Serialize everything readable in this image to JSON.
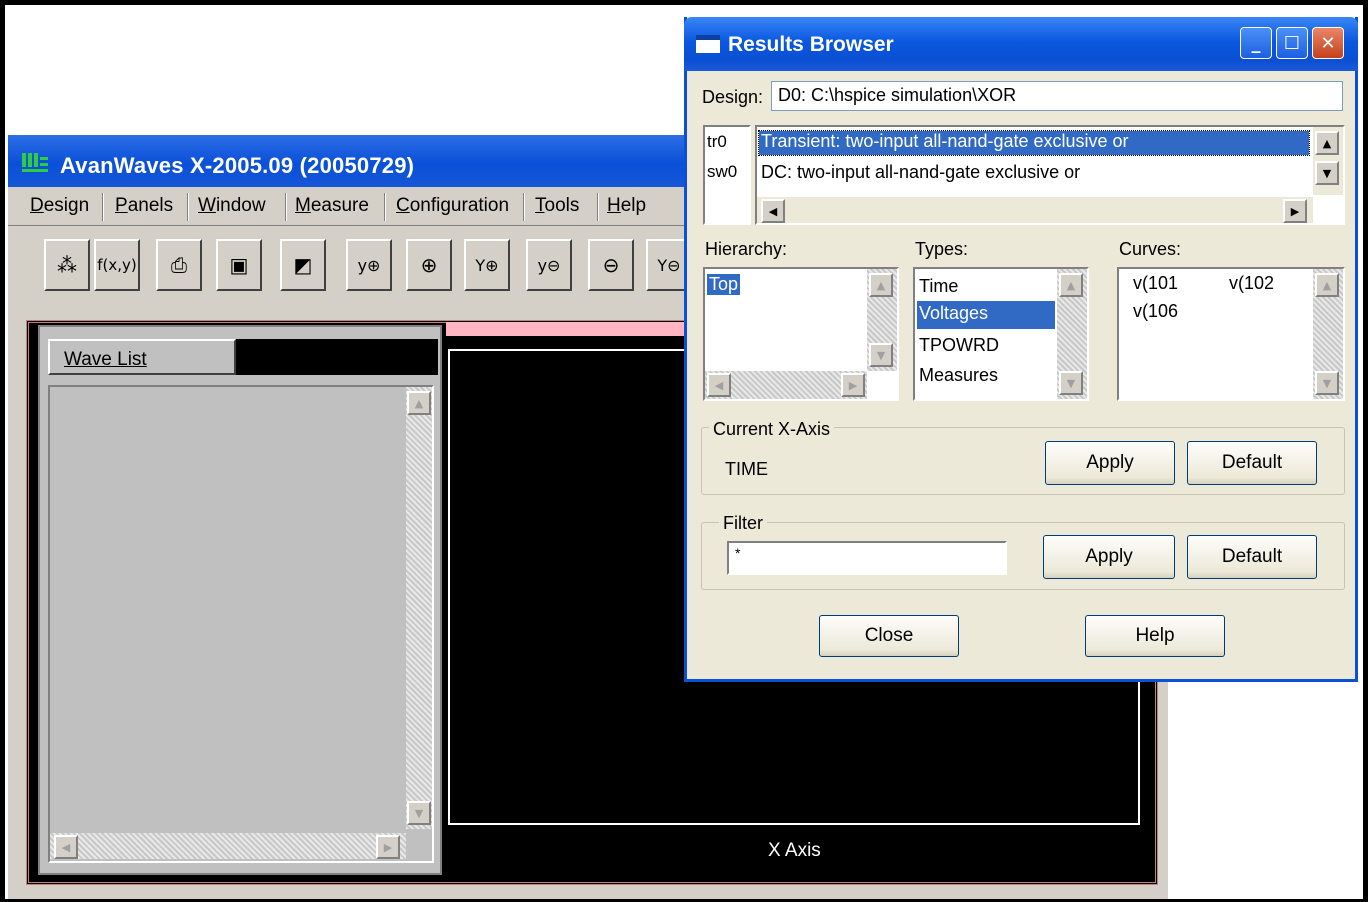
{
  "main_window": {
    "title": "AvanWaves X-2005.09 (20050729)",
    "menu": [
      {
        "label": "Design",
        "u": "D",
        "rest": "esign"
      },
      {
        "label": "Panels",
        "u": "P",
        "rest": "anels"
      },
      {
        "label": "Window",
        "u": "W",
        "rest": "indow"
      },
      {
        "label": "Measure",
        "u": "M",
        "rest": "easure"
      },
      {
        "label": "Configuration",
        "u": "C",
        "rest": "onfiguration"
      },
      {
        "label": "Tools",
        "u": "T",
        "rest": "ools"
      },
      {
        "label": "Help",
        "u": "H",
        "rest": "elp"
      }
    ],
    "toolbar_icons": [
      "hierarchy-icon",
      "function-icon",
      "print-icon",
      "add-panel-icon",
      "add-panel-alt-icon",
      "y-zoom-in-icon",
      "x-zoom-in-icon",
      "y-pan-in-icon",
      "y-zoom-out-icon",
      "x-zoom-out-icon",
      "y-pan-out-icon"
    ],
    "toolbar_glyphs": [
      "⁂",
      "f(x,y)",
      "⎙",
      "▣",
      "◩",
      "y⊕",
      "⊕",
      "Y⊕",
      "y⊖",
      "⊖",
      "Y⊖"
    ],
    "wave_list_tab": "Wave List",
    "x_axis_label": "X Axis"
  },
  "results_browser": {
    "title": "Results Browser",
    "design_label": "Design:",
    "design_value": "D0: C:\\hspice simulation\\XOR",
    "analyses": [
      {
        "id": "tr0",
        "description": "Transient: two-input all-nand-gate exclusive or",
        "selected": true
      },
      {
        "id": "sw0",
        "description": "DC: two-input all-nand-gate exclusive or",
        "selected": false
      }
    ],
    "hierarchy_label": "Hierarchy:",
    "hierarchy_items": [
      {
        "label": "Top",
        "selected": true
      }
    ],
    "types_label": "Types:",
    "types_items": [
      {
        "label": "Time",
        "selected": false
      },
      {
        "label": "Voltages",
        "selected": true
      },
      {
        "label": "TPOWRD",
        "selected": false
      },
      {
        "label": "Measures",
        "selected": false
      }
    ],
    "curves_label": "Curves:",
    "curves_items": [
      "v(101",
      "v(102",
      "v(106"
    ],
    "x_axis_group": "Current X-Axis",
    "x_axis_value": "TIME",
    "filter_group": "Filter",
    "filter_value": "*",
    "apply_label": "Apply",
    "default_label": "Default",
    "close_label": "Close",
    "help_label": "Help"
  },
  "colors": {
    "xp_title_blue": "#0a50d8",
    "selection_blue": "#316ac5",
    "plot_background": "#000000",
    "panel_strip": "#ffb6c1"
  }
}
